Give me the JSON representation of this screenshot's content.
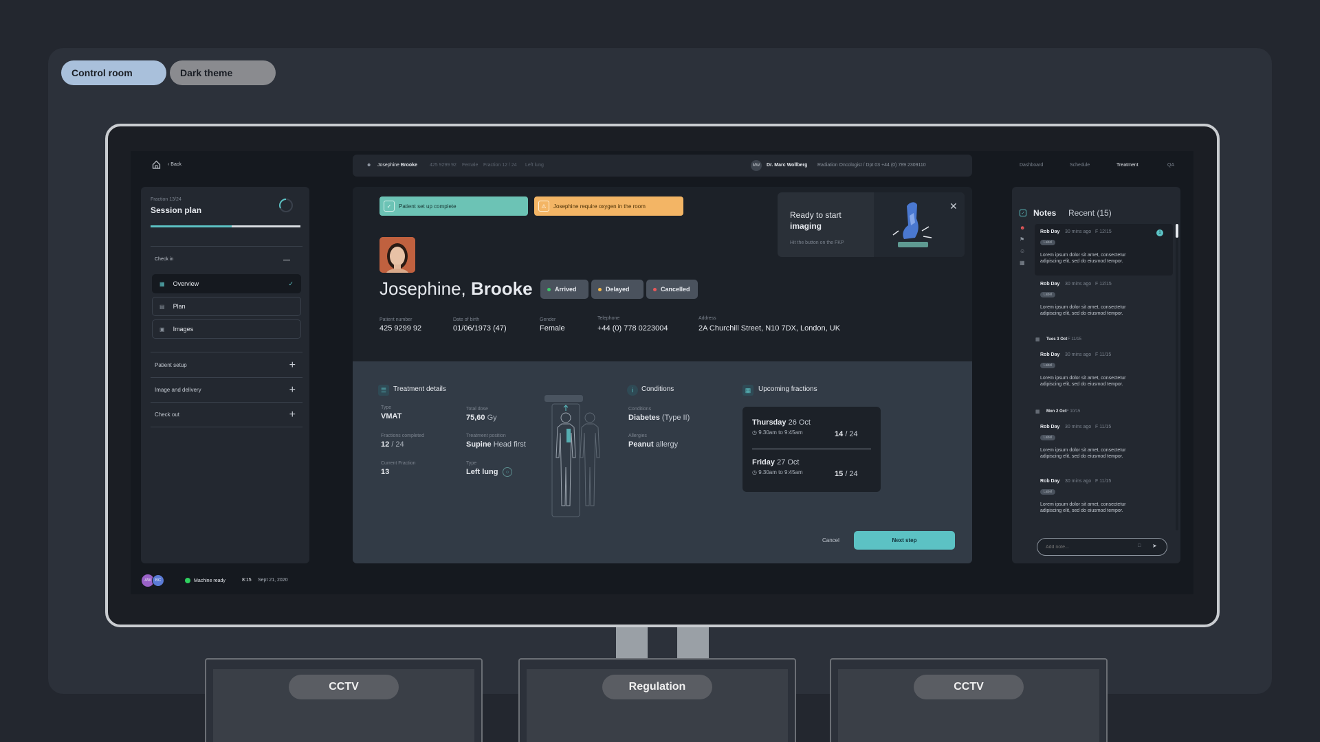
{
  "top_pills": [
    "Control room",
    "Dark theme"
  ],
  "top_nav": {
    "home": "home-icon",
    "back": "Back",
    "links": [
      "Dashboard",
      "Schedule",
      "Treatment",
      "QA"
    ],
    "active": "Treatment"
  },
  "patient_bar": {
    "first": "Josephine",
    "last": "Brooke",
    "number": "425 9299 92",
    "gender": "Female",
    "fraction": "Fraction 12 / 24",
    "site": "Left lung"
  },
  "doctor": {
    "initials": "MW",
    "name": "Dr. Marc Wollberg",
    "role": "Radiation Oncologist / Dpt 03",
    "phone": "+44 (0) 789 2309110"
  },
  "session": {
    "fraction": "Fraction 13/24",
    "title": "Session plan",
    "progress": 0.54
  },
  "checklist": {
    "check_in": "Check in",
    "items": [
      "Overview",
      "Plan",
      "Images"
    ],
    "sections": [
      "Patient setup",
      "Image and delivery",
      "Check out"
    ]
  },
  "status_bar": {
    "avatars": [
      "AW",
      "BC"
    ],
    "machine": "Machine ready",
    "time": "8:15",
    "date": "Sept 21, 2020"
  },
  "alerts": {
    "setup": "Patient set up complete",
    "oxygen": "Josephine require oxygen in the room"
  },
  "ready": {
    "line1": "Ready to start",
    "line2": "imaging",
    "hint": "Hit the button on the FKP"
  },
  "patient": {
    "first": "Josephine,",
    "last": "Brooke",
    "badges": [
      {
        "label": "Arrived",
        "color": "#3ec96b"
      },
      {
        "label": "Delayed",
        "color": "#f5b94a"
      },
      {
        "label": "Cancelled",
        "color": "#e8585a"
      }
    ],
    "fields": [
      {
        "label": "Patient number",
        "value": "425 9299 92"
      },
      {
        "label": "Date of birth",
        "value": "01/06/1973 (47)"
      },
      {
        "label": "Gender",
        "value": "Female"
      },
      {
        "label": "Telephone",
        "value": "+44 (0) 778 0223004"
      },
      {
        "label": "Address",
        "value": "2A Churchill Street, N10 7DX, London, UK"
      }
    ]
  },
  "treatment": {
    "title": "Treatment details",
    "type_label": "Type",
    "type": "VMAT",
    "dose_label": "Total dose",
    "dose": "75,60",
    "dose_unit": "Gy",
    "fc_label": "Fractions completed",
    "fc": "12",
    "fc_total": "/ 24",
    "pos_label": "Treatment position",
    "pos": "Supine",
    "pos_extra": "Head first",
    "cur_label": "Current Fraction",
    "cur": "13",
    "site_label": "Type",
    "site": "Left lung"
  },
  "conditions": {
    "title": "Conditions",
    "cond_label": "Conditions",
    "cond": "Diabetes",
    "cond_extra": "(Type II)",
    "allergy_label": "Allergies",
    "allergy": "Peanut",
    "allergy_extra": "allergy"
  },
  "fractions": {
    "title": "Upcoming fractions",
    "items": [
      {
        "day": "Thursday",
        "date": "26 Oct",
        "time": "9.30am to 9:45am",
        "n": "14",
        "total": "/ 24"
      },
      {
        "day": "Friday",
        "date": "27 Oct",
        "time": "9.30am to 9:45am",
        "n": "15",
        "total": "/ 24"
      }
    ]
  },
  "actions": {
    "cancel": "Cancel",
    "next": "Next step"
  },
  "notes": {
    "title": "Notes",
    "recent": "Recent (15)",
    "unread": "1",
    "groups": [
      {
        "date": "",
        "items": [
          {
            "author": "Rob Day",
            "ago": "30 mins ago",
            "frac": "F 12/15",
            "label": "Label",
            "body": [
              "Lorem ipsum dolor sit amet, consectetur",
              "adipiscing elit, sed do eiusmod tempor."
            ]
          },
          {
            "author": "Rob Day",
            "ago": "30 mins ago",
            "frac": "F 12/15",
            "label": "Label",
            "body": [
              "Lorem ipsum dolor sit amet, consectetur",
              "adipiscing elit, sed do eiusmod tempor."
            ]
          }
        ]
      },
      {
        "date": "Tues 3 Oct",
        "frac": "F 11/15",
        "items": [
          {
            "author": "Rob Day",
            "ago": "30 mins ago",
            "frac": "F 11/15",
            "label": "Label",
            "body": [
              "Lorem ipsum dolor sit amet, consectetur",
              "adipiscing elit, sed do eiusmod tempor."
            ]
          }
        ]
      },
      {
        "date": "Mon 2 Oct",
        "frac": "F 10/15",
        "items": [
          {
            "author": "Rob Day",
            "ago": "30 mins ago",
            "frac": "F 11/15",
            "label": "Label",
            "body": [
              "Lorem ipsum dolor sit amet, consectetur",
              "adipiscing elit, sed do eiusmod tempor."
            ]
          },
          {
            "author": "Rob Day",
            "ago": "30 mins ago",
            "frac": "F 11/15",
            "label": "Label",
            "body": [
              "Lorem ipsum dolor sit amet, consectetur",
              "adipiscing elit, sed do eiusmod tempor."
            ]
          }
        ]
      }
    ],
    "placeholder": "Add note..."
  },
  "sub_monitors": [
    "CCTV",
    "Regulation",
    "CCTV"
  ],
  "colors": {
    "accent": "#5cc2c4",
    "teal_alert": "#6cc3b5",
    "amber_alert": "#f3b565",
    "panel": "#232830",
    "lower_panel": "#323b46"
  }
}
